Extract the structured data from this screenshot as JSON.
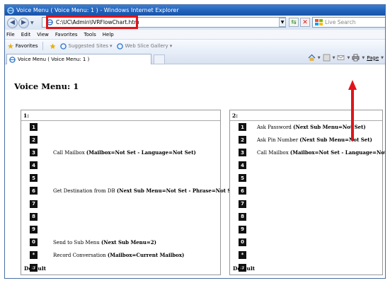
{
  "window": {
    "title": "Voice Menu ( Voice Menu: 1 ) - Windows Internet Explorer"
  },
  "address_bar": {
    "url": "C:\\UC\\Admin\\IVRFlowChart.htm"
  },
  "search": {
    "placeholder": "Live Search"
  },
  "menu": {
    "items": [
      "File",
      "Edit",
      "View",
      "Favorites",
      "Tools",
      "Help"
    ]
  },
  "favorites_bar": {
    "favorites_label": "Favorites",
    "suggested": "Suggested Sites",
    "slice": "Web Slice Gallery"
  },
  "tab": {
    "label": "Voice Menu ( Voice Menu: 1 )"
  },
  "command_bar": {
    "page_label": "Page"
  },
  "page": {
    "title": "Voice Menu: 1"
  },
  "menus": [
    {
      "header": "1:",
      "rows": [
        {
          "key": "1",
          "action": "",
          "detail": ""
        },
        {
          "key": "2",
          "action": "",
          "detail": ""
        },
        {
          "key": "3",
          "action": "Call Mailbox ",
          "detail": "(Mailbox=Not Set - Language=Not Set)"
        },
        {
          "key": "4",
          "action": "",
          "detail": ""
        },
        {
          "key": "5",
          "action": "",
          "detail": ""
        },
        {
          "key": "6",
          "action": "Get Destination from DB ",
          "detail": "(Next Sub Menu=Not Set - Phrase=Not Set)"
        },
        {
          "key": "7",
          "action": "",
          "detail": ""
        },
        {
          "key": "8",
          "action": "",
          "detail": ""
        },
        {
          "key": "9",
          "action": "",
          "detail": ""
        },
        {
          "key": "0",
          "action": "Send to Sub Menu ",
          "detail": "(Next Sub Menu=2)"
        },
        {
          "key": "*",
          "action": "Record Conversation ",
          "detail": "(Mailbox=Current Mailbox)"
        },
        {
          "key": "#",
          "action": "",
          "detail": ""
        }
      ],
      "default_label": "Default"
    },
    {
      "header": "2:",
      "rows": [
        {
          "key": "1",
          "action": "Ask Password ",
          "detail": "(Next Sub Menu=Not Set)"
        },
        {
          "key": "2",
          "action": "Ask Pin Number ",
          "detail": "(Next Sub Menu=Not Set)"
        },
        {
          "key": "3",
          "action": "Call Mailbox ",
          "detail": "(Mailbox=Not Set - Language=Not Set)"
        },
        {
          "key": "4",
          "action": "",
          "detail": ""
        },
        {
          "key": "5",
          "action": "",
          "detail": ""
        },
        {
          "key": "6",
          "action": "",
          "detail": ""
        },
        {
          "key": "7",
          "action": "",
          "detail": ""
        },
        {
          "key": "8",
          "action": "",
          "detail": ""
        },
        {
          "key": "9",
          "action": "",
          "detail": ""
        },
        {
          "key": "0",
          "action": "",
          "detail": ""
        },
        {
          "key": "*",
          "action": "",
          "detail": ""
        },
        {
          "key": "#",
          "action": "",
          "detail": ""
        }
      ],
      "default_label": "Default"
    }
  ],
  "colors": {
    "highlight": "#e0141b",
    "title_bar": "#1f5fb8"
  }
}
